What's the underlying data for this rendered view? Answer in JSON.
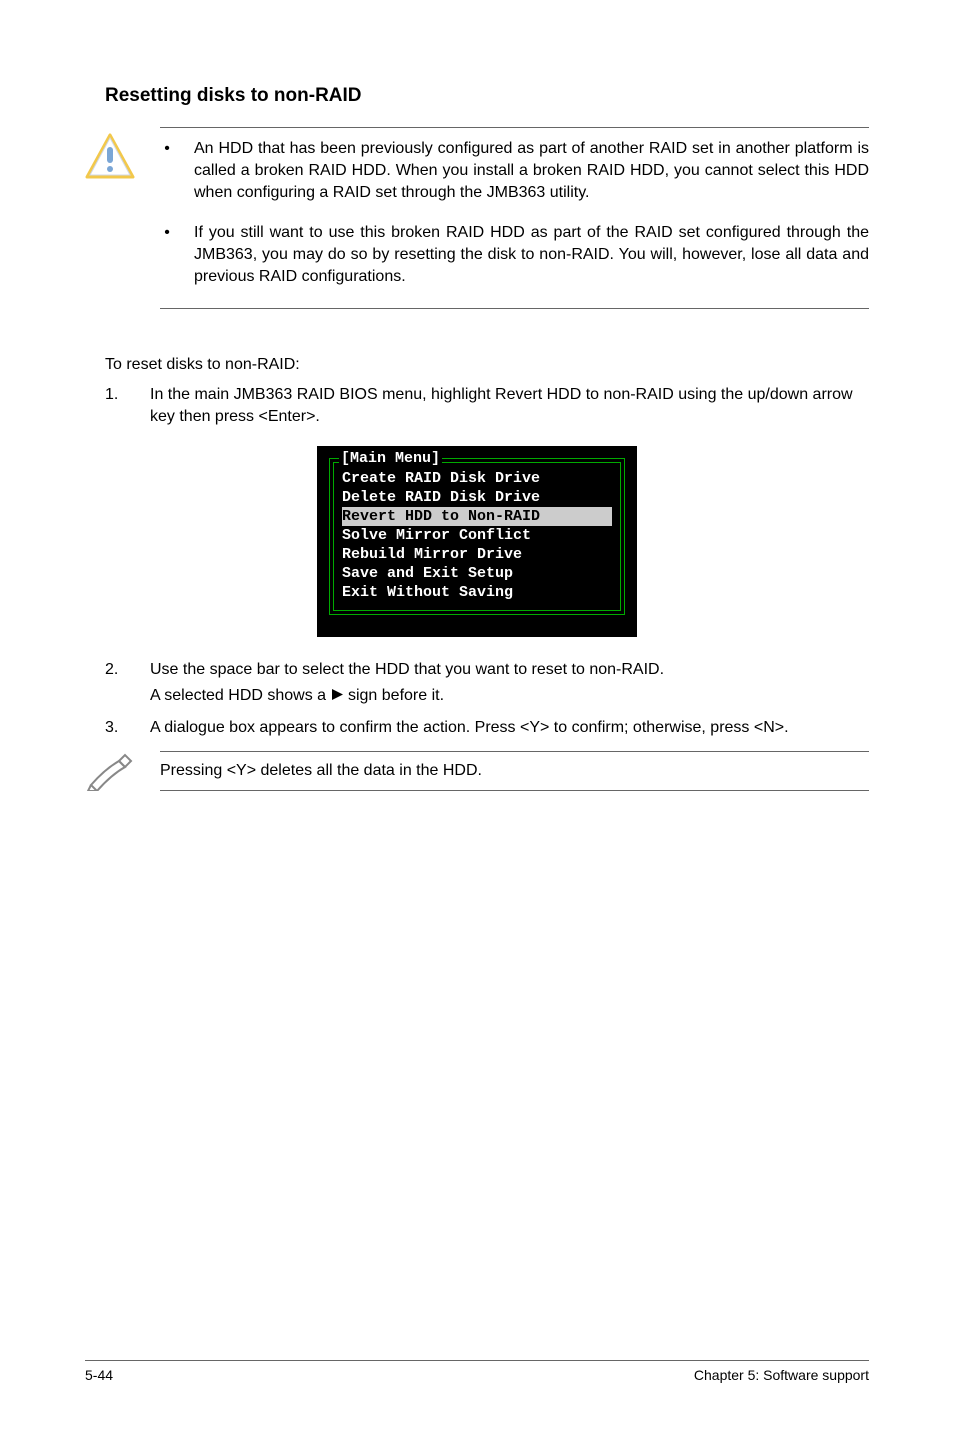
{
  "heading": "Resetting disks to non-RAID",
  "caution": {
    "bullets": [
      "An HDD that has been previously configured as part of another RAID set in another platform is called a broken RAID HDD. When you install a broken RAID HDD, you cannot select this HDD when configuring a RAID set through the JMB363 utility.",
      "If you still want to use this broken RAID HDD as part of the RAID set configured through the JMB363, you may do so by resetting the disk to non-RAID. You will, however, lose all data and previous RAID configurations."
    ]
  },
  "intro": "To reset disks to non-RAID:",
  "steps": [
    {
      "num": "1.",
      "text": "In the main JMB363 RAID BIOS menu, highlight Revert HDD to non-RAID using the up/down arrow key then press <Enter>."
    },
    {
      "num": "2.",
      "text": "Use the space bar to select the HDD that you want to reset to non-RAID.",
      "sub_pre": "A selected HDD shows a ",
      "sub_post": " sign before it."
    },
    {
      "num": "3.",
      "text": "A dialogue box appears to confirm the action. Press <Y> to confirm; otherwise, press <N>."
    }
  ],
  "bios": {
    "title": "[Main Menu]",
    "lines": [
      "Create RAID Disk Drive",
      "Delete RAID Disk Drive"
    ],
    "selected": "Revert HDD to Non-RAID",
    "lines2": [
      "Solve Mirror Conflict",
      "Rebuild Mirror Drive",
      "Save and Exit Setup",
      "Exit Without Saving"
    ]
  },
  "note": "Pressing <Y> deletes all the data in the HDD.",
  "footer": {
    "left": "5-44",
    "right": "Chapter 5: Software support"
  }
}
